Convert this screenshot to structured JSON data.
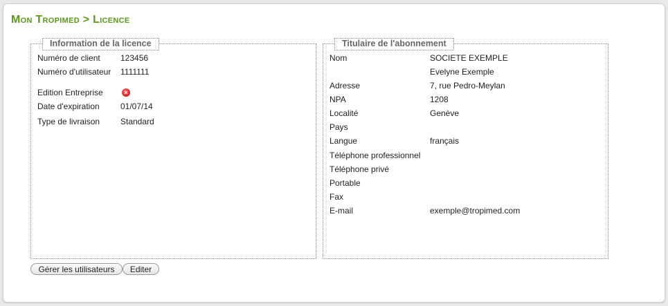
{
  "page": {
    "title": "Mon Tropimed > Licence"
  },
  "licence": {
    "legend": "Information de la licence",
    "client_label": "Numéro de client",
    "client_value": "123456",
    "user_label": "Numéro d'utilisateur",
    "user_value": "1111111",
    "edition_label": "Edition Entreprise",
    "edition_icon": "error-icon",
    "expiry_label": "Date d'expiration",
    "expiry_value": "01/07/14",
    "delivery_label": "Type de livraison",
    "delivery_value": "Standard"
  },
  "holder": {
    "legend": "Titulaire de l'abonnement",
    "rows": [
      {
        "label": "Nom",
        "value": "SOCIETE EXEMPLE"
      },
      {
        "label": "",
        "value": "Evelyne Exemple"
      },
      {
        "label": "Adresse",
        "value": "7, rue Pedro-Meylan"
      },
      {
        "label": "NPA",
        "value": "1208"
      },
      {
        "label": "Localité",
        "value": "Genève"
      },
      {
        "label": "Pays",
        "value": ""
      },
      {
        "label": "Langue",
        "value": "français"
      },
      {
        "label": "Téléphone professionnel",
        "value": ""
      },
      {
        "label": "Téléphone privé",
        "value": ""
      },
      {
        "label": "Portable",
        "value": ""
      },
      {
        "label": "Fax",
        "value": ""
      },
      {
        "label": "E-mail",
        "value": "exemple@tropimed.com"
      }
    ]
  },
  "buttons": {
    "manage_users": "Gérer les utilisateurs",
    "edit": "Editer"
  },
  "colors": {
    "title": "#5a9a16",
    "error": "#c40000"
  }
}
